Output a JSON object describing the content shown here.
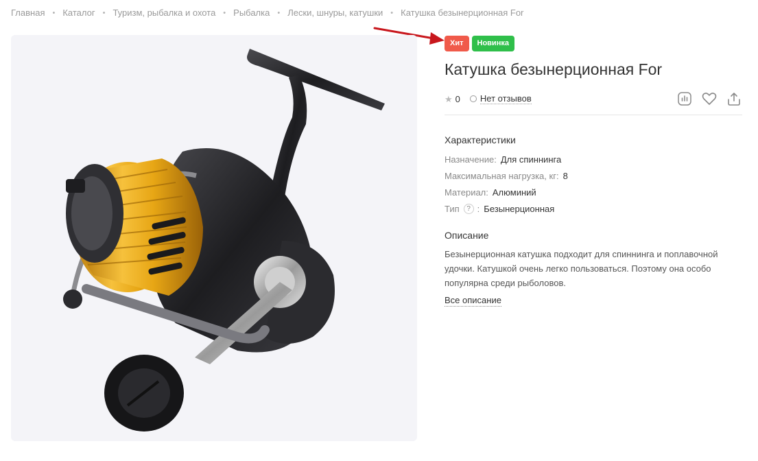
{
  "breadcrumbs": [
    {
      "label": "Главная"
    },
    {
      "label": "Каталог"
    },
    {
      "label": "Туризм, рыбалка и охота"
    },
    {
      "label": "Рыбалка"
    },
    {
      "label": "Лески, шнуры, катушки"
    },
    {
      "label": "Катушка безынерционная For"
    }
  ],
  "badges": {
    "hit": {
      "label": "Хит",
      "color": "#f05a4a"
    },
    "new": {
      "label": "Новинка",
      "color": "#2fbf4a"
    }
  },
  "product": {
    "title": "Катушка безынерционная For",
    "rating": "0",
    "reviews_label": "Нет отзывов",
    "image_icon": "fishing-reel-image"
  },
  "actions": {
    "compare_icon": "compare-chart-icon",
    "favorite_icon": "heart-icon",
    "share_icon": "share-icon"
  },
  "characteristics": {
    "title": "Характеристики",
    "items": [
      {
        "name": "Назначение",
        "value": "Для спиннинга"
      },
      {
        "name": "Максимальная нагрузка, кг",
        "value": "8"
      },
      {
        "name": "Материал",
        "value": "Алюминий"
      },
      {
        "name": "Тип",
        "value": "Безынерционная",
        "help": "?"
      }
    ]
  },
  "description": {
    "title": "Описание",
    "text": "Безынерционная катушка подходит для спиннинга и поплавочной удочки. Катушкой очень легко пользоваться. Поэтому она особо популярна среди рыболовов.",
    "more_label": "Все описание"
  },
  "annotation": {
    "arrow_color": "#c8171d"
  }
}
